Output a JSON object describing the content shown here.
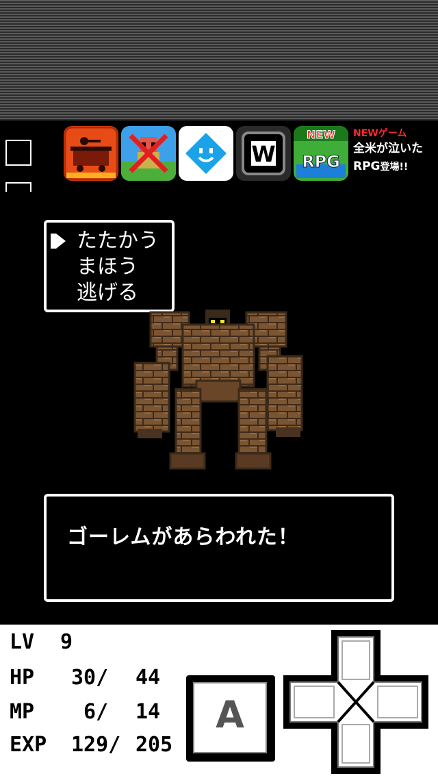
{
  "ads": {
    "items": [
      {
        "name": "ad-app-1",
        "icon": "minecart-app-icon"
      },
      {
        "name": "ad-app-2",
        "icon": "character-app-icon"
      },
      {
        "name": "ad-app-3",
        "icon": "diamond-face-app-icon"
      },
      {
        "name": "ad-app-4",
        "icon": "w-letter-app-icon"
      },
      {
        "name": "ad-app-5",
        "icon": "new-rpg-app-icon",
        "badge": "NEW",
        "label": "RPG"
      }
    ],
    "promo": {
      "line1": "NEWゲーム",
      "line2": "全米が泣いた",
      "line3a": "RPG",
      "line3b": "登場!!"
    }
  },
  "command_menu": {
    "items": [
      "たたかう",
      "まほう",
      "逃げる"
    ],
    "selected_index": 0
  },
  "enemy": {
    "icon": "golem-sprite"
  },
  "message": {
    "text": "ゴーレムがあらわれた！"
  },
  "stats": {
    "lv": {
      "label": "LV",
      "value": "9"
    },
    "hp": {
      "label": "HP",
      "current": "30/",
      "max": "44"
    },
    "mp": {
      "label": "MP",
      "current": "6/",
      "max": "14"
    },
    "exp": {
      "label": "EXP",
      "current": "129/",
      "max": "205"
    }
  },
  "controls": {
    "a_button": "A",
    "dpad_icon": "dpad-icon"
  },
  "colors": {
    "background": "#000000",
    "text": "#ffffff",
    "golem": "#7a5533",
    "golem_dark": "#3a2a1a",
    "golem_eyes": "#f2e12b",
    "promo_red": "#ff2a2a"
  }
}
